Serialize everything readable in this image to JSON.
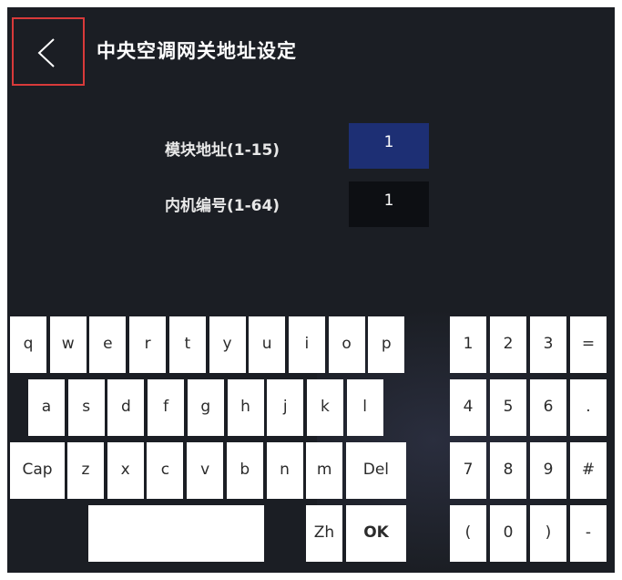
{
  "header": {
    "title": "中央空调网关地址设定",
    "back_icon": "chevron-left-icon",
    "back_border_color": "#d83a3a"
  },
  "form": {
    "module_address": {
      "label": "模块地址(1-15)",
      "value": "1"
    },
    "unit_number": {
      "label": "内机编号(1-64)",
      "value": "1"
    }
  },
  "keyboard": {
    "row1": [
      "q",
      "w",
      "e",
      "r",
      "t",
      "y",
      "u",
      "i",
      "o",
      "p"
    ],
    "row2": [
      "a",
      "s",
      "d",
      "f",
      "g",
      "h",
      "j",
      "k",
      "l"
    ],
    "row3": [
      "Cap",
      "z",
      "x",
      "c",
      "v",
      "b",
      "n",
      "m",
      "Del"
    ],
    "space": "",
    "zh": "Zh",
    "ok": "OK"
  },
  "numpad": [
    "1",
    "2",
    "3",
    "=",
    "4",
    "5",
    "6",
    ".",
    "7",
    "8",
    "9",
    "#",
    "(",
    "0",
    ")",
    "-"
  ],
  "colors": {
    "background": "#1b1e24",
    "active_field": "#1d2f74",
    "idle_field": "#0d0f13",
    "key": "#ffffff"
  }
}
